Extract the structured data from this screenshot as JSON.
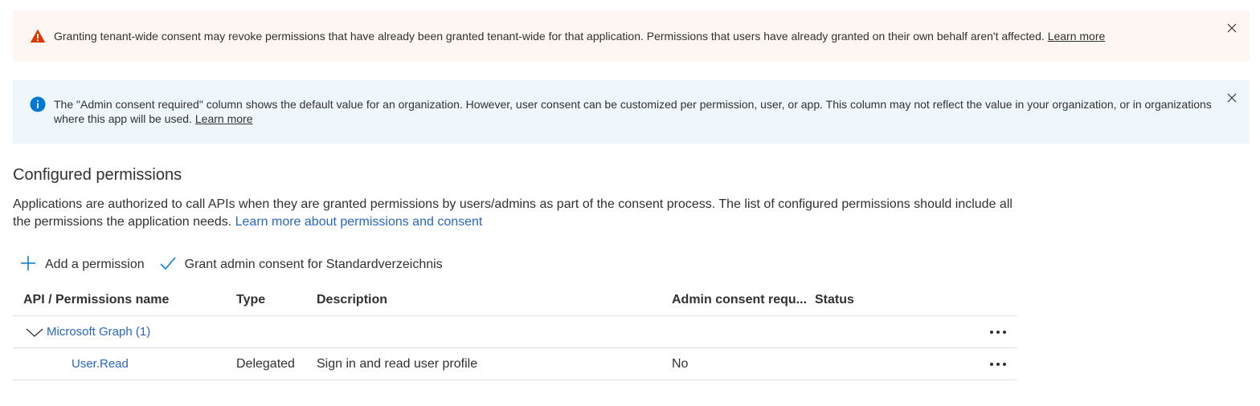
{
  "warning_banner": {
    "text": "Granting tenant-wide consent may revoke permissions that have already been granted tenant-wide for that application. Permissions that users have already granted on their own behalf aren't affected.",
    "link": "Learn more",
    "icon": "warning-icon",
    "color": "#d83b01"
  },
  "info_banner": {
    "text": "The \"Admin consent required\" column shows the default value for an organization. However, user consent can be customized per permission, user, or app. This column may not reflect the value in your organization, or in organizations where this app will be used.",
    "link": "Learn more",
    "icon": "info-icon",
    "color": "#0078d4"
  },
  "section": {
    "title": "Configured permissions",
    "description": "Applications are authorized to call APIs when they are granted permissions by users/admins as part of the consent process. The list of configured permissions should include all the permissions the application needs.",
    "link": "Learn more about permissions and consent"
  },
  "toolbar": {
    "add_label": "Add a permission",
    "grant_label": "Grant admin consent for Standardverzeichnis"
  },
  "table": {
    "headers": [
      "API / Permissions name",
      "Type",
      "Description",
      "Admin consent requ...",
      "Status"
    ],
    "group": {
      "label": "Microsoft Graph (1)"
    },
    "rows": [
      {
        "name": "User.Read",
        "type": "Delegated",
        "description": "Sign in and read user profile",
        "admin_consent": "No",
        "status": ""
      }
    ]
  },
  "colors": {
    "accent": "#0078d4",
    "link": "#2866c4",
    "warning": "#d83b01"
  }
}
